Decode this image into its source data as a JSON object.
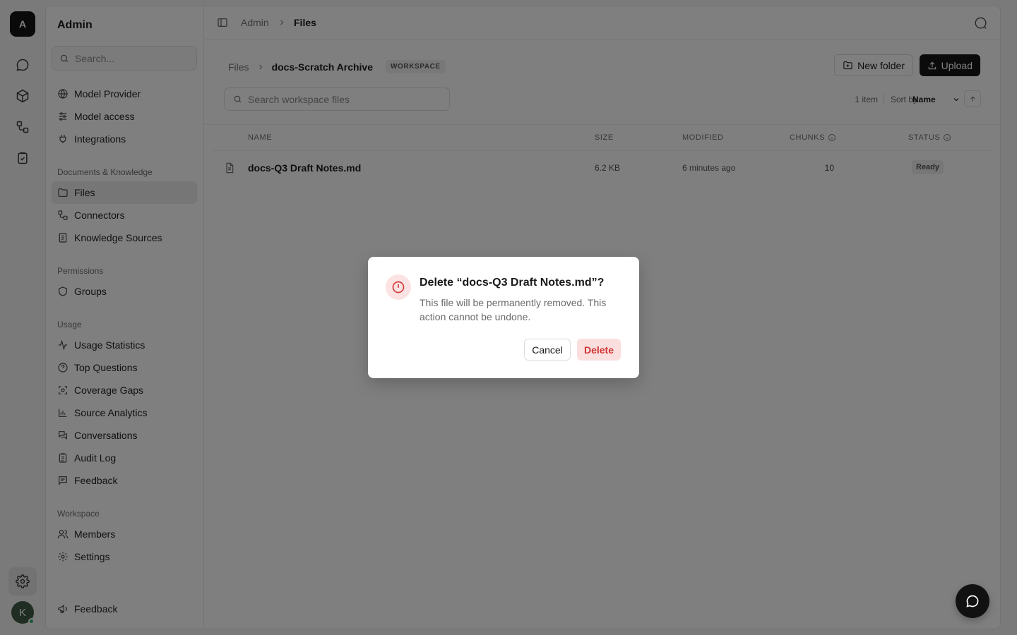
{
  "rail": {
    "logo_letter": "A",
    "icons": [
      "chat-icon",
      "cube-icon",
      "connector-icon",
      "clipboard-check-icon"
    ],
    "settings_icon": "gear-icon",
    "avatar_letter": "K"
  },
  "sidebar": {
    "title": "Admin",
    "search_placeholder": "Search...",
    "top_items": [
      {
        "label": "Model Provider",
        "icon": "globe-icon"
      },
      {
        "label": "Model access",
        "icon": "sliders-icon"
      },
      {
        "label": "Integrations",
        "icon": "plug-icon"
      }
    ],
    "sections": [
      {
        "title": "Documents & Knowledge",
        "items": [
          {
            "label": "Files",
            "icon": "folder-icon",
            "active": true
          },
          {
            "label": "Connectors",
            "icon": "connector-icon"
          },
          {
            "label": "Knowledge Sources",
            "icon": "book-icon"
          }
        ]
      },
      {
        "title": "Permissions",
        "items": [
          {
            "label": "Groups",
            "icon": "shield-icon"
          }
        ]
      },
      {
        "title": "Usage",
        "items": [
          {
            "label": "Usage Statistics",
            "icon": "activity-icon"
          },
          {
            "label": "Top Questions",
            "icon": "help-circle-icon"
          },
          {
            "label": "Coverage Gaps",
            "icon": "scan-icon"
          },
          {
            "label": "Source Analytics",
            "icon": "bar-chart-icon"
          },
          {
            "label": "Conversations",
            "icon": "messages-icon"
          },
          {
            "label": "Audit Log",
            "icon": "clipboard-icon"
          },
          {
            "label": "Feedback",
            "icon": "message-square-icon"
          }
        ]
      },
      {
        "title": "Workspace",
        "items": [
          {
            "label": "Members",
            "icon": "users-icon"
          },
          {
            "label": "Settings",
            "icon": "gear-icon"
          }
        ]
      }
    ],
    "footer_item": {
      "label": "Feedback",
      "icon": "megaphone-icon"
    }
  },
  "topbar": {
    "breadcrumb_root": "Admin",
    "breadcrumb_current": "Files"
  },
  "content": {
    "path_root": "Files",
    "path_current": "docs-Scratch Archive",
    "scope_badge": "WORKSPACE",
    "new_folder_label": "New folder",
    "upload_label": "Upload",
    "search_placeholder": "Search workspace files",
    "item_count": "1 item",
    "sort_label": "Sort by",
    "sort_value": "Name",
    "columns": {
      "name": "NAME",
      "size": "SIZE",
      "modified": "MODIFIED",
      "chunks": "CHUNKS",
      "status": "STATUS"
    },
    "rows": [
      {
        "name": "docs-Q3 Draft Notes.md",
        "size": "6.2 KB",
        "modified": "6 minutes ago",
        "chunks": "10",
        "status": "Ready"
      }
    ]
  },
  "dialog": {
    "title": "Delete “docs-Q3 Draft Notes.md”?",
    "description": "This file will be permanently removed. This action cannot be undone.",
    "cancel_label": "Cancel",
    "delete_label": "Delete",
    "accent_color": "#d23636"
  }
}
